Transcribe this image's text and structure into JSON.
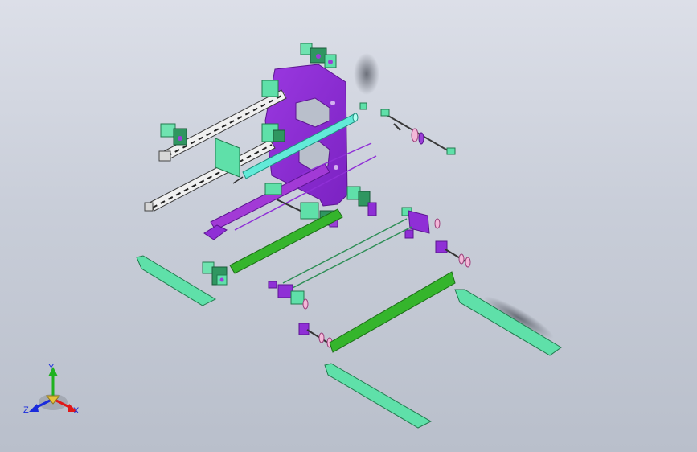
{
  "triad": {
    "y_label": "Y",
    "x_label": "X",
    "z_label": "Z",
    "x_color": "#e01818",
    "y_color": "#1fb21f",
    "z_color": "#1a2bdc"
  },
  "colors": {
    "background_top": "#dcdfe8",
    "background_bottom": "#b9bfcb",
    "plate": "#8f2fd6",
    "part_mint": "#5fe0a9",
    "part_green": "#35b52c",
    "rod_cyan": "#62ead8",
    "tube_purple": "#a23ad6"
  }
}
